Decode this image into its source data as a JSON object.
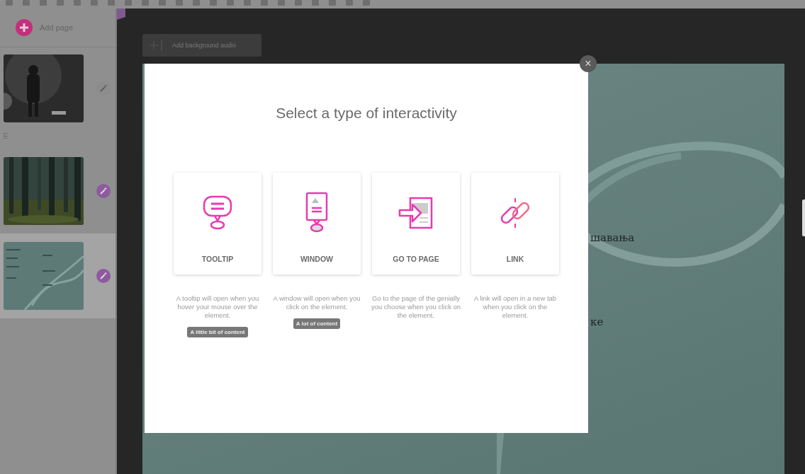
{
  "sidebar": {
    "add_page": "Add page",
    "pages": [
      {
        "kind": "picture",
        "interactive": false,
        "selected": false,
        "caption": "E"
      },
      {
        "kind": "picture",
        "interactive": true,
        "selected": false
      },
      {
        "kind": "picture",
        "interactive": true,
        "selected": true
      }
    ]
  },
  "canvas": {
    "audio_button": "Add background audio",
    "slide_texts": [
      "шавања",
      "ке"
    ]
  },
  "modal": {
    "close": "×",
    "title": "Select a type of interactivity",
    "options": [
      {
        "label": "TOOLTIP",
        "kind": "tooltip",
        "description": "A tooltip will open when you hover your mouse over the element.",
        "badge": "A little bit of content"
      },
      {
        "label": "WINDOW",
        "kind": "window",
        "description": "A window will open when you click on the element.",
        "badge": "A lot of content"
      },
      {
        "label": "GO TO PAGE",
        "kind": "page",
        "description": "Go to the page of the genially you choose when you click on the element."
      },
      {
        "label": "LINK",
        "kind": "link",
        "description": "A link will open in a new tab when you click on the element."
      }
    ]
  }
}
